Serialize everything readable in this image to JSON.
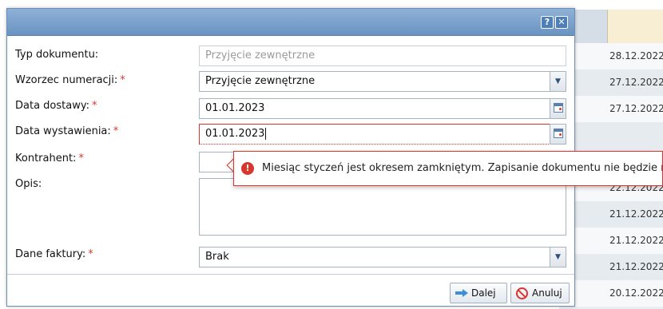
{
  "table": {
    "dates": [
      "28.12.2022",
      "27.12.2022",
      "27.12.2022",
      "",
      "22.12.2022",
      "21.12.2022",
      "21.12.2022",
      "21.12.2022",
      "20.12.2022"
    ]
  },
  "dialog": {
    "help_label": "?",
    "close_label": "✕",
    "fields": {
      "doc_type": {
        "label": "Typ dokumentu:",
        "value": "Przyjęcie zewnętrzne"
      },
      "numbering": {
        "label": "Wzorzec numeracji:",
        "value": "Przyjęcie zewnętrzne"
      },
      "delivery_date": {
        "label": "Data dostawy:",
        "value": "01.01.2023"
      },
      "issue_date": {
        "label": "Data wystawienia:",
        "value": "01.01.2023"
      },
      "contractor": {
        "label": "Kontrahent:",
        "value": ""
      },
      "description": {
        "label": "Opis:",
        "value": ""
      },
      "invoice": {
        "label": "Dane faktury:",
        "value": "Brak"
      }
    },
    "required_mark": "*",
    "buttons": {
      "next": "Dalej",
      "cancel": "Anuluj"
    },
    "error": {
      "icon": "!",
      "message": "Miesiąc styczeń jest okresem zamkniętym. Zapisanie dokumentu nie będzie możliwe"
    }
  },
  "colors": {
    "accent": "#6a93c2",
    "error": "#d9362d"
  }
}
